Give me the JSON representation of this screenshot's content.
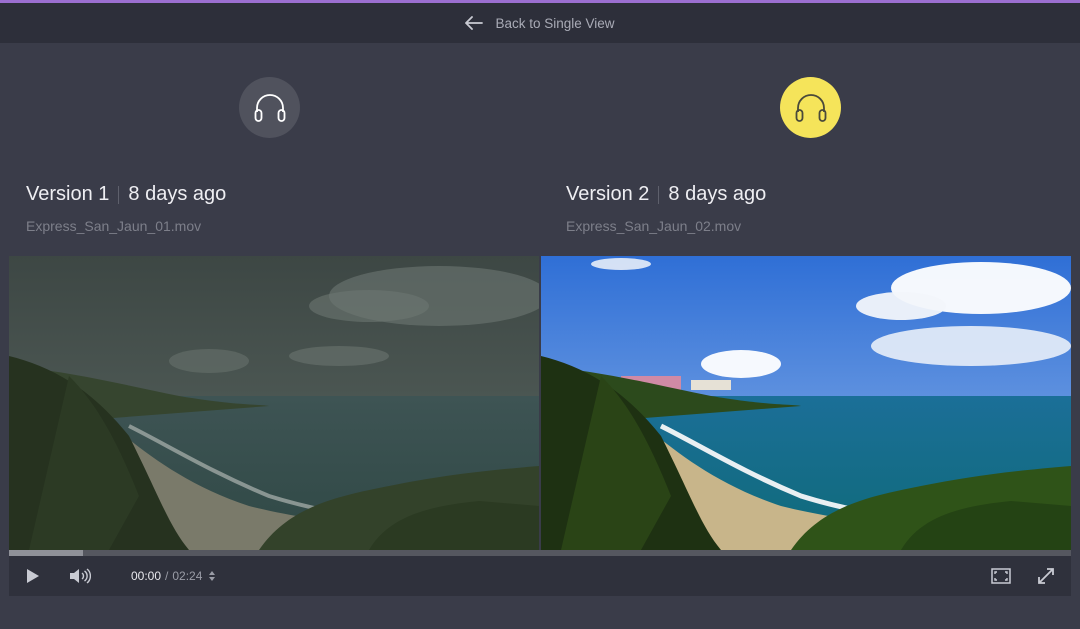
{
  "topbar": {
    "back_label": "Back to Single View"
  },
  "versions": [
    {
      "label": "Version 1",
      "age": "8 days ago",
      "filename": "Express_San_Jaun_01.mov",
      "audio_active": false
    },
    {
      "label": "Version 2",
      "age": "8 days ago",
      "filename": "Express_San_Jaun_02.mov",
      "audio_active": true
    }
  ],
  "player": {
    "current_time": "00:00",
    "separator": "/",
    "duration": "02:24",
    "progress_fraction": 0.07
  },
  "colors": {
    "accent": "#9b6fd0",
    "audio_active": "#f5e45a",
    "audio_inactive": "#50525d"
  }
}
